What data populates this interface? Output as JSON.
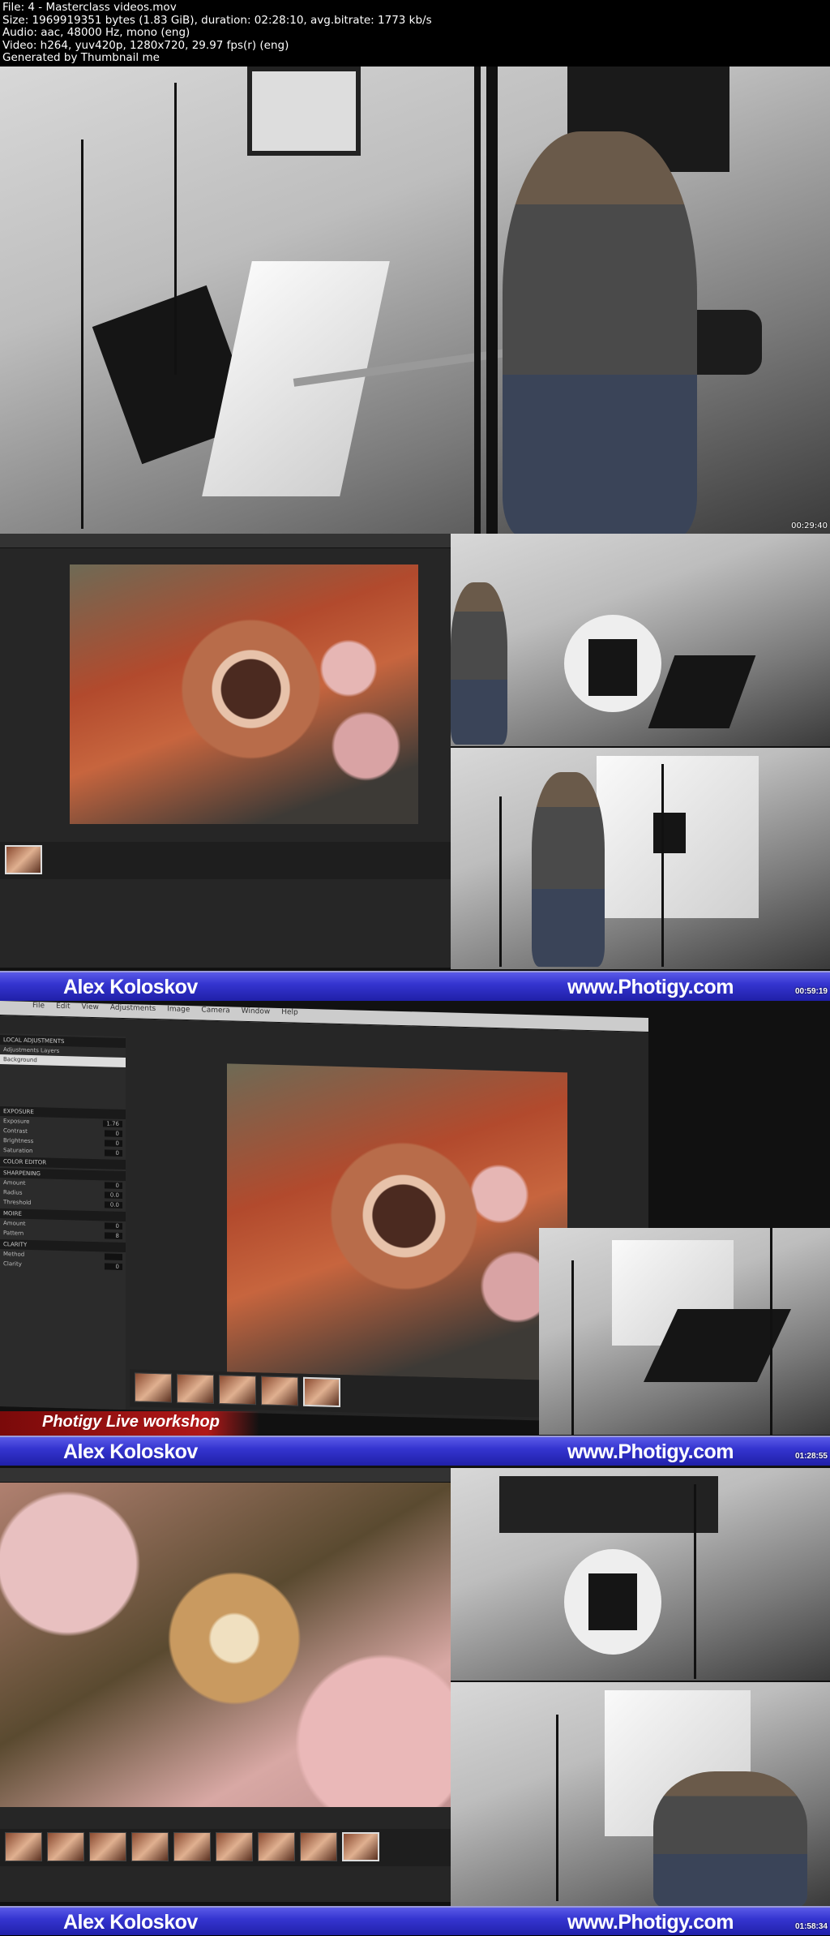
{
  "header": {
    "lines": [
      "File: 4 - Masterclass videos.mov",
      "Size: 1969919351 bytes (1.83 GiB), duration: 02:28:10, avg.bitrate: 1773 kb/s",
      "Audio: aac, 48000 Hz, mono (eng)",
      "Video: h264, yuv420p, 1280x720, 29.97 fps(r) (eng)",
      "Generated by Thumbnail me"
    ]
  },
  "frames": [
    {
      "timestamp": "00:29:40"
    },
    {
      "timestamp": "00:59:19",
      "banner": {
        "name": "Alex Koloskov",
        "url": "www.Photigy.com"
      }
    },
    {
      "timestamp": "01:28:55",
      "banner": {
        "name": "Alex Koloskov",
        "url": "www.Photigy.com"
      },
      "lower_third": "Photigy Live workshop",
      "menu": [
        "File",
        "Edit",
        "View",
        "Adjustments",
        "Image",
        "Camera",
        "Window",
        "Help"
      ],
      "panel": {
        "local": "LOCAL ADJUSTMENTS",
        "layers": [
          "Adjustments Layers",
          "Background"
        ],
        "sections": [
          {
            "title": "EXPOSURE",
            "rows": [
              {
                "label": "Exposure",
                "value": "1.76"
              },
              {
                "label": "Contrast",
                "value": "0"
              },
              {
                "label": "Brightness",
                "value": "0"
              },
              {
                "label": "Saturation",
                "value": "0"
              }
            ]
          },
          {
            "title": "COLOR EDITOR",
            "rows": []
          },
          {
            "title": "SHARPENING",
            "rows": [
              {
                "label": "Amount",
                "value": "0"
              },
              {
                "label": "Radius",
                "value": "0.0"
              },
              {
                "label": "Threshold",
                "value": "0.0"
              }
            ]
          },
          {
            "title": "MOIRE",
            "rows": [
              {
                "label": "Amount",
                "value": "0"
              },
              {
                "label": "Pattern",
                "value": "8"
              }
            ]
          },
          {
            "title": "CLARITY",
            "rows": [
              {
                "label": "Method",
                "value": ""
              },
              {
                "label": "Clarity",
                "value": "0"
              }
            ]
          }
        ]
      }
    },
    {
      "timestamp": "01:58:34",
      "banner": {
        "name": "Alex Koloskov",
        "url": "www.Photigy.com"
      }
    }
  ]
}
